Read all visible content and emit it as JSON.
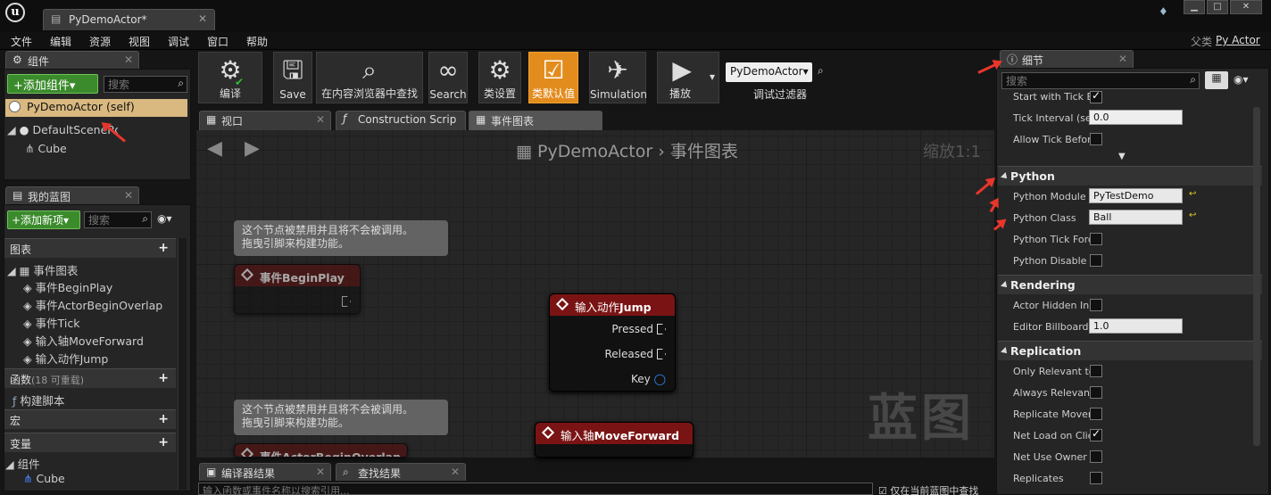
{
  "window": {
    "tab_title": "PyDemoActor*",
    "parent_label": "父类",
    "parent_value": "Py Actor"
  },
  "menu": [
    "文件",
    "编辑",
    "资源",
    "视图",
    "调试",
    "窗口",
    "帮助"
  ],
  "components_panel": {
    "tab": "组件",
    "add_button": "+添加组件▾",
    "search_placeholder": "搜索",
    "self_item": "PyDemoActor (self)",
    "root_item": "DefaultSceneRoot",
    "child_item": "Cube"
  },
  "blueprint_panel": {
    "tab": "我的蓝图",
    "add_button": "+添加新项▾",
    "search_placeholder": "搜索",
    "graphs_header": "图表",
    "event_graph": "事件图表",
    "events": [
      "事件BeginPlay",
      "事件ActorBeginOverlap",
      "事件Tick",
      "输入轴MoveForward",
      "输入动作Jump"
    ],
    "functions_header": "函数",
    "functions_hint": "(18 可重载)",
    "construction_script": "构建脚本",
    "macros_header": "宏",
    "variables_header": "变量",
    "components_header": "组件",
    "components_item": "Cube"
  },
  "toolbar": {
    "compile": "编译",
    "save": "Save",
    "browse": "在内容浏览器中查找",
    "search": "Search",
    "class_settings": "类设置",
    "class_defaults": "类默认值",
    "simulation": "Simulation",
    "play": "播放",
    "debug_select": "PyDemoActor▾",
    "debug_filter": "调试过滤器"
  },
  "editor_tabs": {
    "viewport": "视口",
    "construction": "Construction Scrip",
    "event_graph": "事件图表"
  },
  "graph": {
    "breadcrumb_class": "PyDemoActor",
    "breadcrumb_sep": "›",
    "breadcrumb_graph": "事件图表",
    "zoom": "缩放1:1",
    "watermark": "蓝图",
    "comment_line1": "这个节点被禁用并且将不会被调用。",
    "comment_line2": "拖曳引脚来构建功能。",
    "node_beginplay": "事件BeginPlay",
    "node_overlap": "事件ActorBeginOverlap",
    "node_jump_prefix": "输入动作",
    "node_jump_bold": "Jump",
    "pin_pressed": "Pressed",
    "pin_released": "Released",
    "pin_key": "Key",
    "node_move_prefix": "输入轴",
    "node_move_bold": "MoveForward"
  },
  "bottom_tabs": {
    "compiler": "编译器结果",
    "find": "查找结果",
    "find_placeholder": "输入函数或事件名称以搜索引用...",
    "find_checkbox": "仅在当前蓝图中查找"
  },
  "details": {
    "tab": "细节",
    "search_placeholder": "搜索",
    "rows_top": [
      {
        "label": "Start with Tick Enabled",
        "type": "check",
        "checked": true
      },
      {
        "label": "Tick Interval (secs)",
        "type": "value",
        "value": "0.0"
      },
      {
        "label": "Allow Tick Before BeginPlay",
        "type": "check",
        "checked": false
      }
    ],
    "python_header": "Python",
    "python_module_label": "Python Module",
    "python_module_value": "PyTestDemo",
    "python_class_label": "Python Class",
    "python_class_value": "Ball",
    "python_tick_label": "Python Tick Force",
    "python_disable_label": "Python Disable Autotick",
    "rendering_header": "Rendering",
    "actor_hidden_label": "Actor Hidden In Game",
    "billboard_label": "Editor Billboard Scale",
    "billboard_value": "1.0",
    "replication_header": "Replication",
    "repl_rows": [
      {
        "label": "Only Relevant to Owner",
        "checked": false
      },
      {
        "label": "Always Relevant",
        "checked": false
      },
      {
        "label": "Replicate Movement",
        "checked": false
      },
      {
        "label": "Net Load on Client",
        "checked": true
      },
      {
        "label": "Net Use Owner Relevancy",
        "checked": false
      },
      {
        "label": "Replicates",
        "checked": false
      }
    ]
  },
  "colors": {
    "accent_red": "#e8362c",
    "green": "#3b8b2c",
    "node_red": "#7a1414",
    "default_orange": "#e38c1e"
  }
}
